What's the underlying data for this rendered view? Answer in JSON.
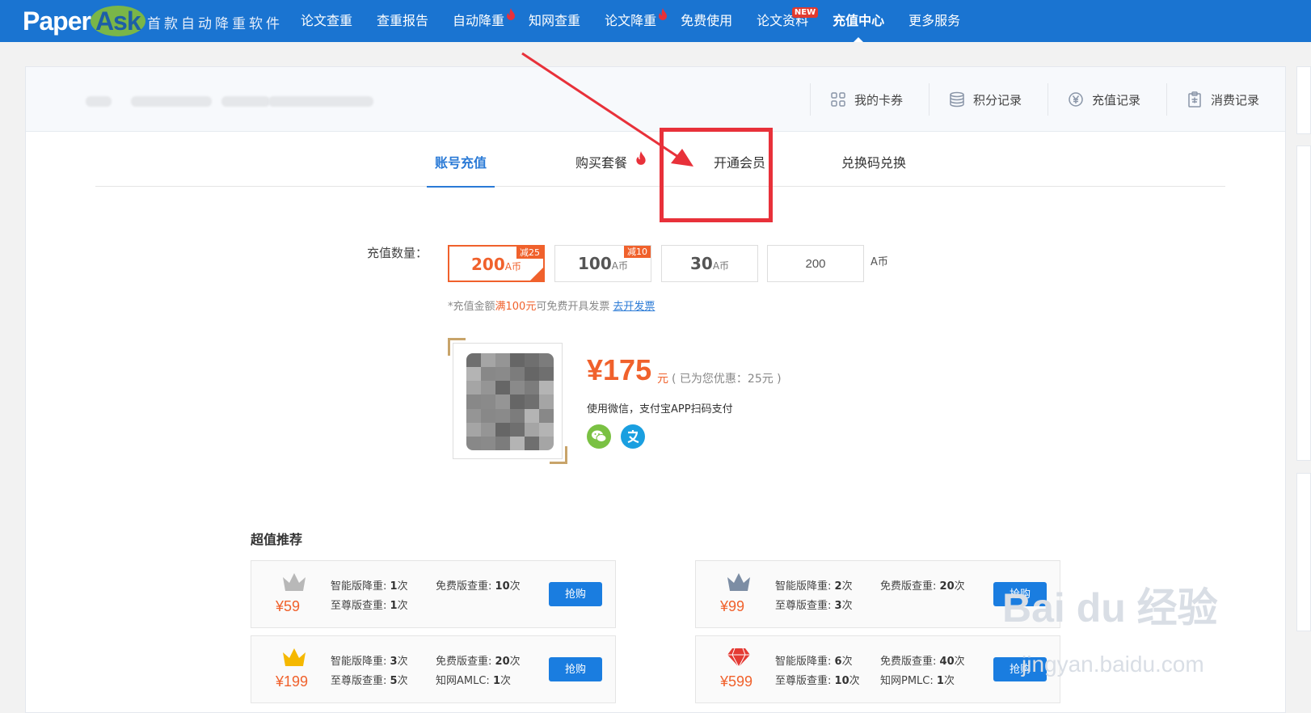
{
  "brand": {
    "part1": "Paper",
    "part2": "Ask",
    "slogan": "首款自动降重软件"
  },
  "nav": [
    {
      "label": "论文查重"
    },
    {
      "label": "查重报告"
    },
    {
      "label": "自动降重",
      "hot": true
    },
    {
      "label": "知网查重"
    },
    {
      "label": "论文降重",
      "hot": true
    },
    {
      "label": "免费使用"
    },
    {
      "label": "论文资料",
      "badge": "NEW"
    },
    {
      "label": "充值中心",
      "active": true
    },
    {
      "label": "更多服务"
    }
  ],
  "header_links": [
    {
      "label": "我的卡券",
      "icon": "grid-icon"
    },
    {
      "label": "积分记录",
      "icon": "coins-icon"
    },
    {
      "label": "充值记录",
      "icon": "yen-circle-icon"
    },
    {
      "label": "消费记录",
      "icon": "clipboard-icon"
    }
  ],
  "tabs": [
    {
      "label": "账号充值",
      "active": true
    },
    {
      "label": "购买套餐",
      "hot": true
    },
    {
      "label": "开通会员"
    },
    {
      "label": "兑换码兑换"
    }
  ],
  "recharge": {
    "label": "充值数量：",
    "options": [
      {
        "amount": "200",
        "unit": "A币",
        "discount": "减25",
        "selected": true
      },
      {
        "amount": "100",
        "unit": "A币",
        "discount": "减10"
      },
      {
        "amount": "30",
        "unit": "A币"
      }
    ],
    "custom_value": "200",
    "custom_unit": "A币",
    "note_prefix": "*充值金额",
    "note_highlight": "满100元",
    "note_suffix": "可免费开具发票",
    "note_link": "去开发票"
  },
  "payment": {
    "price": "¥175",
    "unit": "元",
    "saved": "( 已为您优惠：25元 )",
    "desc": "使用微信，支付宝APP扫码支付",
    "methods": [
      {
        "icon": "wechat-icon",
        "color": "#7ac143"
      },
      {
        "icon": "alipay-icon",
        "color": "#1a9fe0"
      }
    ]
  },
  "recommend": {
    "title": "超值推荐",
    "packages": [
      {
        "price": "¥59",
        "crown": "silver-crown-icon",
        "rows": [
          [
            "智能版降重:",
            "1",
            "次"
          ],
          [
            "免费版查重:",
            "10",
            "次"
          ],
          [
            "至尊版查重:",
            "1",
            "次"
          ]
        ],
        "button": "抢购"
      },
      {
        "price": "¥99",
        "crown": "steel-crown-icon",
        "rows": [
          [
            "智能版降重:",
            "2",
            "次"
          ],
          [
            "免费版查重:",
            "20",
            "次"
          ],
          [
            "至尊版查重:",
            "3",
            "次"
          ]
        ],
        "button": "抢购"
      },
      {
        "price": "¥199",
        "crown": "gold-crown-icon",
        "rows": [
          [
            "智能版降重:",
            "3",
            "次"
          ],
          [
            "免费版查重:",
            "20",
            "次"
          ],
          [
            "至尊版查重:",
            "5",
            "次"
          ],
          [
            "知网AMLC:",
            "1",
            "次"
          ]
        ],
        "button": "抢购"
      },
      {
        "price": "¥599",
        "crown": "diamond-icon",
        "rows": [
          [
            "智能版降重:",
            "6",
            "次"
          ],
          [
            "免费版查重:",
            "40",
            "次"
          ],
          [
            "至尊版查重:",
            "10",
            "次"
          ],
          [
            "知网PMLC:",
            "1",
            "次"
          ]
        ],
        "button": "抢购"
      }
    ]
  },
  "watermark": {
    "text": "Bai du 经验",
    "url": "jingyan.baidu.com"
  }
}
